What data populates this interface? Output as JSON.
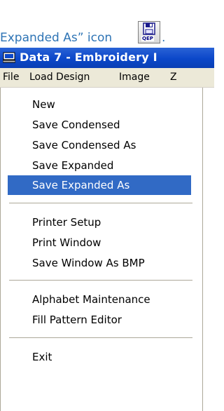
{
  "caption": {
    "text": "Expanded As” icon",
    "trailing": ".",
    "icon_label": "QEP"
  },
  "window": {
    "title": "Data 7 - Embroidery I",
    "icon": "computer-icon"
  },
  "menubar": {
    "items": [
      {
        "label": "File"
      },
      {
        "label": "Load Design"
      },
      {
        "label": "Image"
      },
      {
        "label": "Z"
      }
    ]
  },
  "file_menu": {
    "items": [
      {
        "label": "New"
      },
      {
        "label": "Save Condensed"
      },
      {
        "label": "Save Condensed As"
      },
      {
        "label": "Save Expanded"
      },
      {
        "label": "Save Expanded As",
        "highlighted": true
      },
      {
        "label": "Printer Setup"
      },
      {
        "label": "Print Window"
      },
      {
        "label": "Save Window As BMP"
      },
      {
        "label": "Alphabet Maintenance"
      },
      {
        "label": "Fill Pattern Editor"
      },
      {
        "label": "Exit"
      }
    ]
  },
  "colors": {
    "titlebar": "#0b47c9",
    "highlight": "#316ac5",
    "caption_text": "#2e74b5",
    "menubar": "#ece9d8"
  }
}
